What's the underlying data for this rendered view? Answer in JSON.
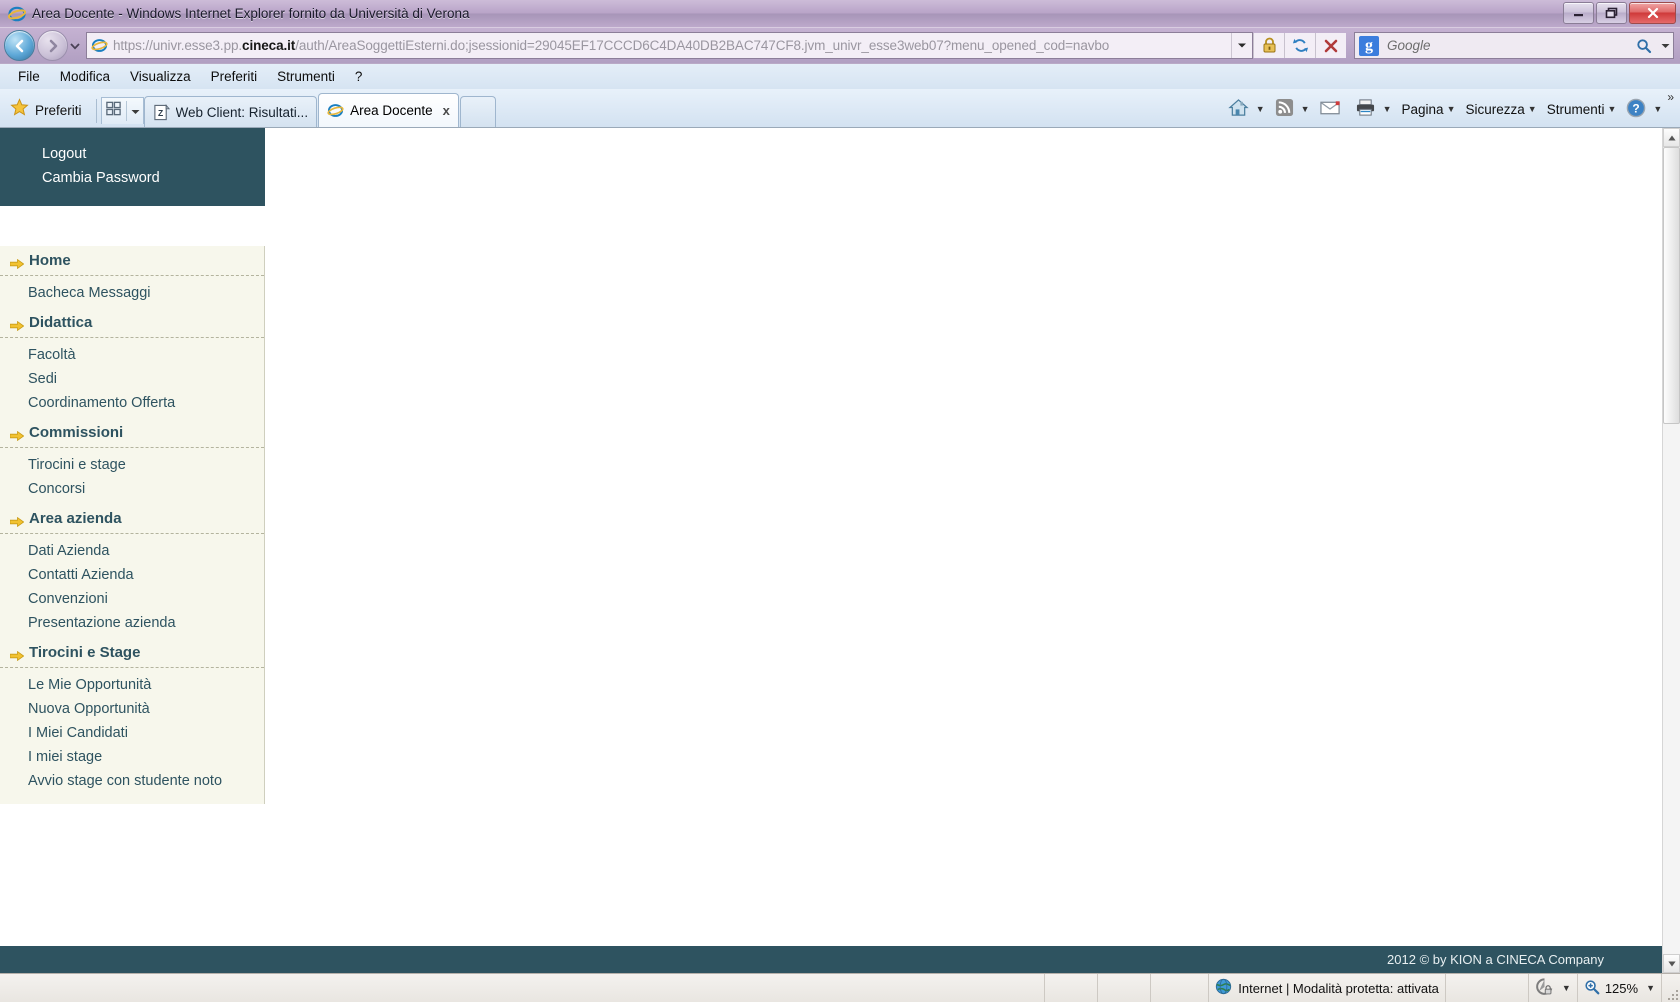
{
  "window": {
    "title": "Area Docente - Windows Internet Explorer fornito da Università di Verona",
    "icon": "ie-icon",
    "minimize_label": "minimize-icon",
    "maximize_label": "restore-icon",
    "close_label": "close-icon"
  },
  "address": {
    "back_icon": "back-arrow-icon",
    "forward_icon": "forward-arrow-icon",
    "history_caret": "chevron-down-icon",
    "url_scheme": "https://",
    "url_host_pre": "univr.esse3.pp.",
    "url_host_bold": "cineca.it",
    "url_path": "/auth/AreaSoggettiEsterni.do;jsessionid=29045EF17CCCD6C4DA40DB2BAC747CF8.jvm_univr_esse3web07?menu_opened_cod=navbo",
    "dropdown_icon": "chevron-down-icon",
    "lock_icon": "padlock-icon",
    "refresh_icon": "refresh-icon",
    "stop_icon": "stop-x-icon",
    "search_provider": "Google",
    "search_placeholder": "Google",
    "search_value": ""
  },
  "menubar": {
    "items": [
      {
        "label": "File"
      },
      {
        "label": "Modifica"
      },
      {
        "label": "Visualizza"
      },
      {
        "label": "Preferiti"
      },
      {
        "label": "Strumenti"
      },
      {
        "label": "?"
      }
    ]
  },
  "favorites": {
    "label": "Preferiti",
    "star_icon": "star-icon",
    "quicklaunch_icon": "quick-tabs-icon",
    "quicklaunch_caret": "chevron-down-icon"
  },
  "tabs": [
    {
      "label": "Web Client: Risultati...",
      "icon": "zimbra-icon",
      "active": false,
      "close": ""
    },
    {
      "label": "Area Docente",
      "icon": "ie-icon",
      "active": true,
      "close": "x"
    }
  ],
  "new_tab": {
    "label": "",
    "name": "new-tab-button"
  },
  "commandbar": {
    "home": {
      "icon": "home-icon",
      "caret": "chevron-down-icon"
    },
    "feeds": {
      "icon": "rss-feed-icon",
      "caret": "chevron-down-icon"
    },
    "mail": {
      "icon": "mail-icon"
    },
    "print": {
      "icon": "printer-icon",
      "caret": "chevron-down-icon"
    },
    "page": {
      "label": "Pagina",
      "caret": "chevron-down-icon"
    },
    "security": {
      "label": "Sicurezza",
      "caret": "chevron-down-icon"
    },
    "tools": {
      "label": "Strumenti",
      "caret": "chevron-down-icon"
    },
    "help": {
      "icon": "help-question-icon",
      "caret": "chevron-down-icon"
    },
    "overflow": {
      "label": "»"
    }
  },
  "sidebar": {
    "user_actions": [
      {
        "label": "Logout"
      },
      {
        "label": "Cambia Password"
      }
    ],
    "sections": [
      {
        "heading": "Home",
        "arrow_icon": "yellow-arrow-icon",
        "links": [
          {
            "label": "Bacheca Messaggi"
          }
        ]
      },
      {
        "heading": "Didattica",
        "arrow_icon": "yellow-arrow-icon",
        "links": [
          {
            "label": "Facoltà"
          },
          {
            "label": "Sedi"
          },
          {
            "label": "Coordinamento Offerta"
          }
        ]
      },
      {
        "heading": "Commissioni",
        "arrow_icon": "yellow-arrow-icon",
        "links": [
          {
            "label": "Tirocini e stage"
          },
          {
            "label": "Concorsi"
          }
        ]
      },
      {
        "heading": "Area azienda",
        "arrow_icon": "yellow-arrow-icon",
        "links": [
          {
            "label": "Dati Azienda"
          },
          {
            "label": "Contatti Azienda"
          },
          {
            "label": "Convenzioni"
          },
          {
            "label": "Presentazione azienda"
          }
        ]
      },
      {
        "heading": "Tirocini e Stage",
        "arrow_icon": "yellow-arrow-icon",
        "links": [
          {
            "label": "Le Mie Opportunità"
          },
          {
            "label": "Nuova Opportunità"
          },
          {
            "label": "I Miei Candidati"
          },
          {
            "label": "I miei stage"
          },
          {
            "label": "Avvio stage con studente noto"
          }
        ]
      }
    ]
  },
  "footer": {
    "copyright": "2012 © by KION a CINECA Company"
  },
  "statusbar": {
    "zone_icon": "globe-icon",
    "zone_text": "Internet | Modalità protetta: attivata",
    "protected_icon": "protected-mode-icon",
    "protected_caret": "chevron-down-icon",
    "zoom_icon": "zoom-icon",
    "zoom_level": "125%",
    "zoom_caret": "chevron-down-icon"
  },
  "colors": {
    "brand_dark": "#2e5360",
    "sidebar_bg": "#f7f7ec",
    "accent_yellow": "#f2c230",
    "chrome_purple": "#b9a7c4"
  }
}
